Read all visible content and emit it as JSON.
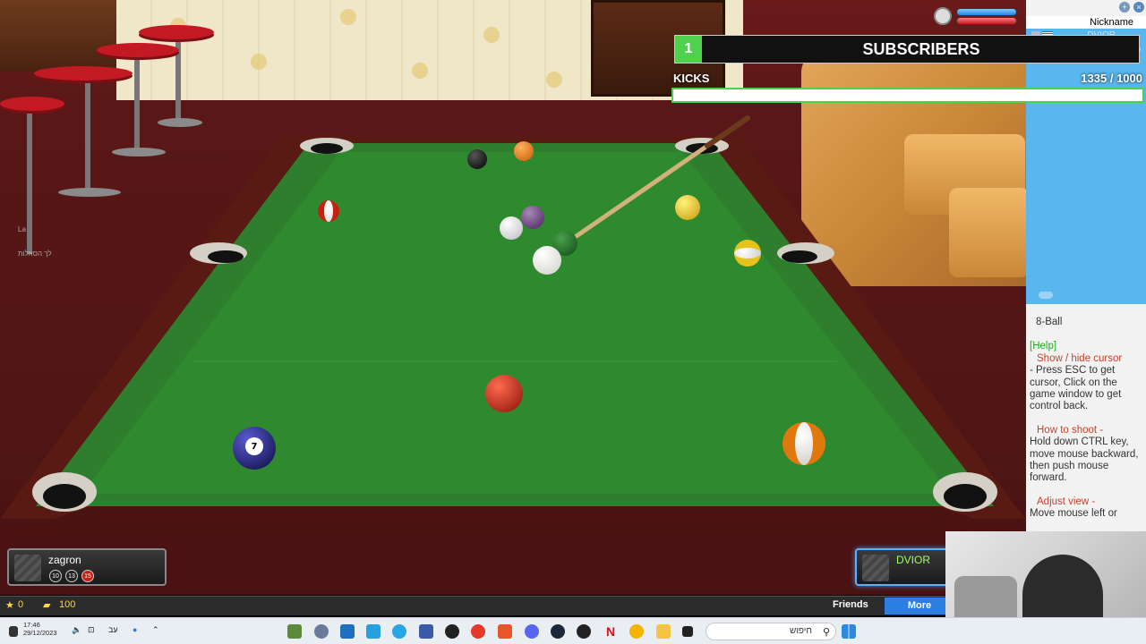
{
  "hud": {
    "subscribers_count": "1",
    "subscribers_label": "SUBSCRIBERS",
    "kicks_label": "KICKS",
    "kicks_count": "1335",
    "kicks_total": "/ 1000",
    "kicks_fraction": 1.0
  },
  "sidebar": {
    "nickname_header": "Nickname",
    "players": [
      {
        "nick": "DVIOR",
        "score": ""
      },
      {
        "nick": "zagron",
        "score": "15"
      }
    ],
    "game_mode": "8-Ball",
    "help_tag": "[Help]",
    "sections": [
      {
        "heading": "Show / hide cursor",
        "body": "- Press ESC to get cursor, Click on the game window to get control back."
      },
      {
        "heading": "How to shoot -",
        "body": "Hold down CTRL key, move mouse backward, then push mouse forward."
      },
      {
        "heading": "Adjust view -",
        "body": "Move mouse left or"
      }
    ]
  },
  "players": {
    "left": {
      "name": "zagron",
      "balls": [
        "10",
        "13",
        "15"
      ]
    },
    "right": {
      "name": "DVIOR"
    }
  },
  "bottom_bar": {
    "stars": "0",
    "coins": "100",
    "friends": "Friends",
    "more": "More"
  },
  "taskbar": {
    "time": "17:46",
    "date": "29/12/2023",
    "lang": "עב",
    "search": "חיפוש"
  },
  "left_overlay": {
    "line1": "La",
    "line2": "לך הסאלות"
  },
  "colors": {
    "felt": "#2f8a2f",
    "rail_wood": "#5a1a14",
    "accent_green": "#4fd14f",
    "accent_blue": "#2a7fe0"
  },
  "balls": [
    {
      "id": "7",
      "color": "#1a1a6a",
      "stripe": false
    },
    {
      "id": "3",
      "color": "#c8200f",
      "stripe": false
    },
    {
      "id": "13",
      "color": "#e0780e",
      "stripe": true
    },
    {
      "id": "8",
      "color": "#111111",
      "stripe": false
    },
    {
      "id": "5",
      "color": "#e0780e",
      "stripe": false
    },
    {
      "id": "1",
      "color": "#e6c21a",
      "stripe": false
    },
    {
      "id": "9",
      "color": "#e6c21a",
      "stripe": true
    },
    {
      "id": "11",
      "color": "#c8200f",
      "stripe": true
    },
    {
      "id": "12",
      "color": "#4a2060",
      "stripe": true
    },
    {
      "id": "4",
      "color": "#5a3a6a",
      "stripe": false
    },
    {
      "id": "6",
      "color": "#1c6a2c",
      "stripe": false
    },
    {
      "id": "cue",
      "color": "#f5f5f0",
      "stripe": false
    }
  ]
}
